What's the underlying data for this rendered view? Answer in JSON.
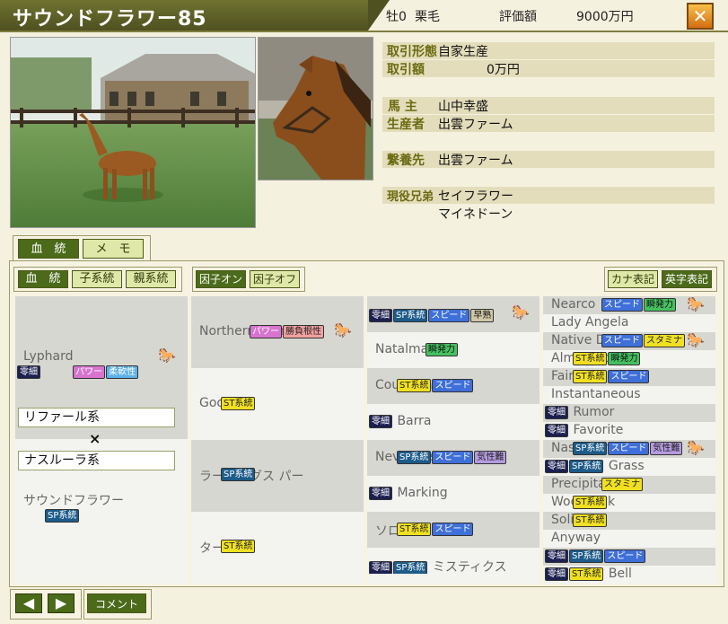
{
  "header": {
    "name": "サウンドフラワー85",
    "sex_age": "牡0",
    "coat": "栗毛",
    "value_label": "評価額",
    "value": "9000万円"
  },
  "info": {
    "trade_type_label": "取引形態",
    "trade_type": "自家生産",
    "trade_amount_label": "取引額",
    "trade_amount": "0万円",
    "owner_label": "馬 主",
    "owner": "山中幸盛",
    "breeder_label": "生産者",
    "breeder": "出雲ファーム",
    "stable_label": "繋養先",
    "stable": "出雲ファーム",
    "siblings_label": "現役兄弟",
    "siblings": [
      "セイフラワー",
      "マイネドーン"
    ]
  },
  "tabs": {
    "pedigree": "血　統",
    "memo": "メ　モ"
  },
  "subtabs": {
    "pedigree": "血　統",
    "sire_line": "子系統",
    "parent_line": "親系統"
  },
  "factor": {
    "on": "因子オン",
    "off": "因子オフ"
  },
  "notation": {
    "kana": "カナ表記",
    "english": "英字表記"
  },
  "badges": {
    "zero": "零細",
    "sp": "SP系統",
    "st": "ST系統",
    "speed": "スピード",
    "power": "パワー",
    "flex": "柔軟性",
    "burst": "瞬発力",
    "stamina": "スタミナ",
    "temper": "気性難",
    "win": "勝負根性",
    "early": "早熟"
  },
  "pedigree": {
    "sire": "Lyphard",
    "sire_line": "リファール系",
    "cross": "×",
    "dam_line": "ナスルーラ系",
    "dam": "サウンドフラワー",
    "g2": [
      "Northern Dancer",
      "Goofed",
      "ラーピングス パー",
      "ターフ"
    ],
    "g3": [
      "",
      "Natalma",
      "Court Martial",
      "Barra",
      "Never Bend",
      "Marking",
      "ソロ",
      "ミスティクス"
    ],
    "g4": [
      "Nearco",
      "Lady Angela",
      "Native Dancer",
      "Almahmoud",
      "Fair Trial",
      "Instantaneous",
      "Rumor",
      "Favorite",
      "Nasrullah",
      "Grass",
      "Precipitation",
      "Woodcock",
      "Solitario",
      "Anyway",
      "",
      "Bell"
    ]
  },
  "footer": {
    "comment": "コメント",
    "prev": "◀",
    "next": "▶"
  },
  "icons": [
    "horse-icon",
    "close-icon",
    "left-arrow-icon",
    "right-arrow-icon"
  ]
}
